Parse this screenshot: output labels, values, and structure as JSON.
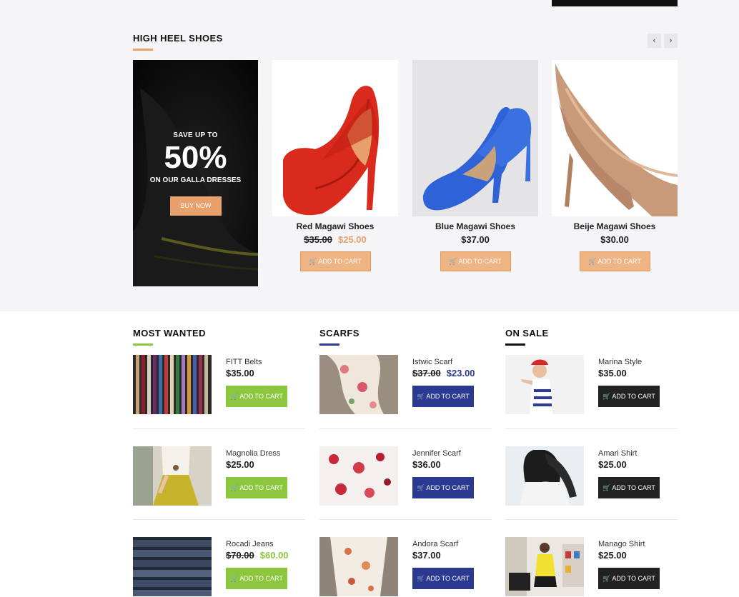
{
  "top_section": {
    "title": "HIGH HEEL SHOES",
    "accent": "#e8a06c",
    "nav": {
      "prev_icon": "‹",
      "next_icon": "›"
    },
    "promo": {
      "save_text": "SAVE UP TO",
      "percent": "50%",
      "subtitle": "ON OUR GALLA DRESSES",
      "button": "BUY NOW"
    },
    "products": [
      {
        "name": "Red Magawi Shoes",
        "old_price": "$35.00",
        "price": "$25.00",
        "button": "ADD TO CART",
        "color": "#d9261c"
      },
      {
        "name": "Blue Magawi Shoes",
        "old_price": "",
        "price": "$37.00",
        "button": "ADD TO CART",
        "color": "#2f66d8"
      },
      {
        "name": "Beije Magawi Shoes",
        "old_price": "",
        "price": "$30.00",
        "button": "ADD TO CART",
        "color": "#c9a080"
      }
    ]
  },
  "columns": [
    {
      "title": "MOST WANTED",
      "accent": "#8dc63f",
      "button_color": "#8dc63f",
      "price_color": "#8dc63f",
      "items": [
        {
          "name": "FITT Belts",
          "old_price": "",
          "price": "$35.00",
          "button": "ADD TO CART"
        },
        {
          "name": "Magnolia Dress",
          "old_price": "",
          "price": "$25.00",
          "button": "ADD TO CART"
        },
        {
          "name": "Rocadi Jeans",
          "old_price": "$70.00",
          "price": "$60.00",
          "button": "ADD TO CART"
        }
      ]
    },
    {
      "title": "SCARFS",
      "accent": "#2b3990",
      "button_color": "#2b3990",
      "price_color": "#2b3990",
      "items": [
        {
          "name": "Istwic Scarf",
          "old_price": "$37.00",
          "price": "$23.00",
          "button": "ADD TO CART"
        },
        {
          "name": "Jennifer Scarf",
          "old_price": "",
          "price": "$36.00",
          "button": "ADD TO CART"
        },
        {
          "name": "Andora Scarf",
          "old_price": "",
          "price": "$37.00",
          "button": "ADD TO CART"
        }
      ]
    },
    {
      "title": "ON SALE",
      "accent": "#111111",
      "button_color": "#222222",
      "price_color": "#222222",
      "items": [
        {
          "name": "Marina Style",
          "old_price": "",
          "price": "$35.00",
          "button": "ADD TO CART"
        },
        {
          "name": "Amari Shirt",
          "old_price": "",
          "price": "$25.00",
          "button": "ADD TO CART"
        },
        {
          "name": "Manago Shirt",
          "old_price": "",
          "price": "$25.00",
          "button": "ADD TO CART"
        }
      ]
    }
  ]
}
